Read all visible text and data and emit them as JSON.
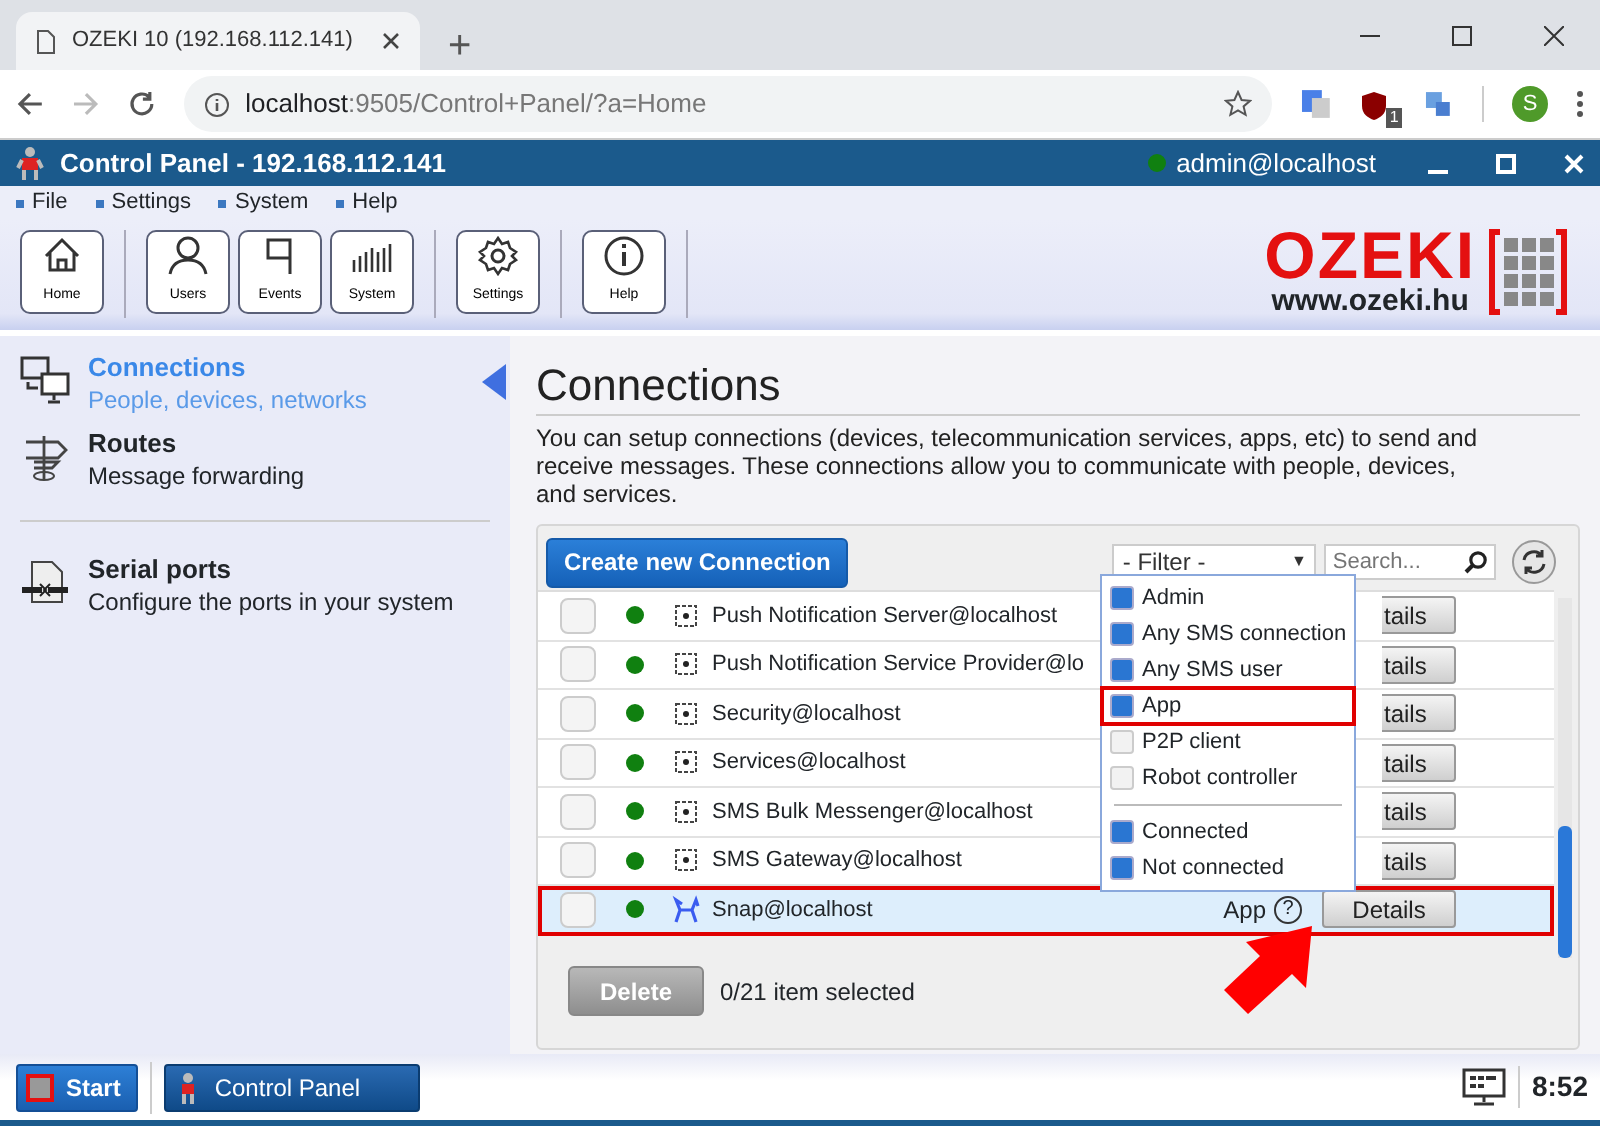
{
  "browser": {
    "tab_title": "OZEKI 10 (192.168.112.141)",
    "new_tab": "+",
    "url_host": "localhost",
    "url_path": ":9505/Control+Panel/?a=Home",
    "extension_badge": "1",
    "profile_initial": "S"
  },
  "app": {
    "title": "Control Panel - 192.168.112.141",
    "user": "admin@localhost",
    "online": true
  },
  "menu": [
    "File",
    "Settings",
    "System",
    "Help"
  ],
  "toolbar": [
    {
      "label": "Home"
    },
    {
      "label": "Users"
    },
    {
      "label": "Events"
    },
    {
      "label": "System"
    },
    {
      "label": "Settings"
    },
    {
      "label": "Help"
    }
  ],
  "logo": {
    "name": "OZEKI",
    "site": "www.ozeki.hu"
  },
  "sidebar": {
    "items": [
      {
        "title": "Connections",
        "subtitle": "People, devices, networks",
        "selected": true
      },
      {
        "title": "Routes",
        "subtitle": "Message forwarding",
        "selected": false
      },
      {
        "title": "Serial ports",
        "subtitle": "Configure the ports in your system",
        "selected": false
      }
    ]
  },
  "page": {
    "title": "Connections",
    "description": "You can setup connections (devices, telecommunication services, apps, etc) to send and receive messages. These connections allow you to communicate with people, devices, and services."
  },
  "panel": {
    "create_button": "Create new Connection",
    "filter": {
      "label": "- Filter -",
      "caret": "▼",
      "expanded": true
    },
    "search": {
      "placeholder": "Search..."
    },
    "rows": [
      {
        "name": "Push Notification Server@localhost",
        "connected": true,
        "kind": "service",
        "details": "tails",
        "highlighted": false
      },
      {
        "name": "Push Notification Service Provider@lo",
        "connected": true,
        "kind": "service",
        "details": "tails",
        "highlighted": false
      },
      {
        "name": "Security@localhost",
        "connected": true,
        "kind": "service",
        "details": "tails",
        "highlighted": false
      },
      {
        "name": "Services@localhost",
        "connected": true,
        "kind": "service",
        "details": "tails",
        "highlighted": false
      },
      {
        "name": "SMS Bulk Messenger@localhost",
        "connected": true,
        "kind": "service",
        "details": "tails",
        "highlighted": false
      },
      {
        "name": "SMS Gateway@localhost",
        "connected": true,
        "kind": "service",
        "details": "tails",
        "highlighted": false
      },
      {
        "name": "Snap@localhost",
        "connected": true,
        "kind": "app",
        "type": "App",
        "help": "?",
        "details": "Details",
        "highlighted": true
      }
    ],
    "filter_groups": [
      [
        {
          "label": "Admin",
          "checked": true,
          "highlighted": false
        },
        {
          "label": "Any SMS connection",
          "checked": true,
          "highlighted": false
        },
        {
          "label": "Any SMS user",
          "checked": true,
          "highlighted": false
        },
        {
          "label": "App",
          "checked": true,
          "highlighted": true
        },
        {
          "label": "P2P client",
          "checked": false,
          "highlighted": false
        },
        {
          "label": "Robot controller",
          "checked": false,
          "highlighted": false
        }
      ],
      [
        {
          "label": "Connected",
          "checked": true,
          "highlighted": false
        },
        {
          "label": "Not connected",
          "checked": true,
          "highlighted": false
        }
      ]
    ],
    "delete_button": "Delete",
    "selection_count": "0/21 item selected"
  },
  "taskbar": {
    "start": "Start",
    "tasks": [
      "Control Panel"
    ],
    "clock": "8:52"
  }
}
